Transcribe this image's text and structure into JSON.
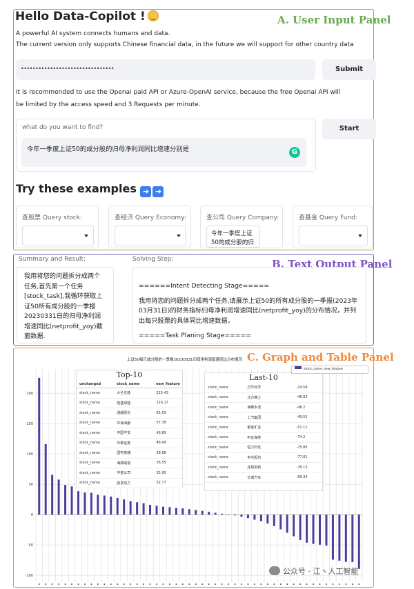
{
  "panels": {
    "a_title": "A. User Input Panel",
    "b_title": "B. Text Output Panel",
    "c_title": "C. Graph and Table Panel"
  },
  "header": {
    "title": "Hello Data-Copilot !",
    "subtitle_1": "A powerful AI system connects humans and data.",
    "subtitle_2": "The current version only supports Chinese financial data, in the future we will support for other country data"
  },
  "api": {
    "key_value": "••••••••••••••••••••••••••••••••",
    "submit_label": "Submit",
    "note_1": "It is recommended to use the Openai paid API or Azure-OpenAI service, because the free Openai API will",
    "note_2": "be limited by the access speed and 3 Requests per minute."
  },
  "query": {
    "label": "what do you want to find?",
    "value": "今年一季度上证50的成分股的归母净利润同比增速分别是",
    "start_label": "Start"
  },
  "examples": {
    "heading": "Try these examples",
    "items": [
      {
        "label": "查股票 Query stock:",
        "value": ""
      },
      {
        "label": "查经济 Query Economy:",
        "value": ""
      },
      {
        "label": "查公司 Query Company:",
        "value": "今年一季度上证50的成分股的归母净"
      },
      {
        "label": "查基金 Query Fund:",
        "value": ""
      }
    ]
  },
  "output": {
    "summary_label": "Summary and Result:",
    "summary_text": "我用将您的问题拆分成两个任务,首先第一个任务[stock_task],我循环获取上证50所有成分股的一季报20230331日的归母净利润增速同比(netprofit_yoy)截面数据.\n然后第二个任务",
    "solving_label": "Solving Step:",
    "solving_line1": "======Intent Detecting Stage=====",
    "solving_text": "我用将您的问题拆分成两个任务,请展示上证50的所有成分股的一季报(2023年03月31日)的财务指标归母净利润增速同比(netprofit_yoy)的分布情况，并列出每只股票的具体同比增速数据。",
    "solving_line3": "=====Task Planing Stage====="
  },
  "chart_data": {
    "type": "bar",
    "title": "上证50每只成分股的一季报20230331归母净利润增速同比分布情况",
    "legend": "stock_name_new_feature",
    "legend_position": "top-right",
    "yticks": [
      200,
      150,
      100,
      50,
      0,
      -50,
      -100
    ],
    "ylim": [
      -110,
      240
    ],
    "color": "#4b3f9a",
    "values": [
      225.43,
      116.17,
      65.59,
      57.78,
      48.89,
      46.49,
      38.68,
      36.55,
      35.95,
      32.77,
      31.5,
      29.8,
      27.6,
      25.1,
      22.3,
      20.4,
      18.9,
      16.2,
      14.7,
      13.1,
      12.4,
      11.2,
      10.3,
      9.1,
      7.6,
      6.2,
      4.8,
      3.1,
      1.6,
      0.4,
      -1.2,
      -3.5,
      -5.8,
      -8.3,
      -10.9,
      -14.6,
      -18.8,
      -24.2,
      -29.9,
      -35.6,
      -41.7,
      -46.2,
      -48.2,
      -49.55,
      -51.11,
      -74.2,
      -75.86,
      -77.81,
      -78.13,
      -89.34
    ],
    "top10": {
      "title": "Top-10",
      "headers": [
        "unchanged",
        "stock_name",
        "new_feature"
      ],
      "rows": [
        [
          "stock_name",
          "大全光能",
          "225.43"
        ],
        [
          "stock_name",
          "隆基绿能",
          "116.17"
        ],
        [
          "stock_name",
          "通威股份",
          "65.59"
        ],
        [
          "stock_name",
          "中海油服",
          "57.78"
        ],
        [
          "stock_name",
          "中国平安",
          "48.89"
        ],
        [
          "stock_name",
          "华泰证券",
          "46.49"
        ],
        [
          "stock_name",
          "国电南瑞",
          "38.68"
        ],
        [
          "stock_name",
          "海康威视",
          "36.55"
        ],
        [
          "stock_name",
          "中金公司",
          "35.95"
        ],
        [
          "stock_name",
          "航发动力",
          "32.77"
        ]
      ]
    },
    "last10": {
      "title": "Last-10",
      "rows": [
        [
          "stock_name",
          "万华化学",
          "-24.58"
        ],
        [
          "stock_name",
          "北方稀土",
          "-46.83"
        ],
        [
          "stock_name",
          "海螺水泥",
          "-48.2"
        ],
        [
          "stock_name",
          "上汽集团",
          "-49.55"
        ],
        [
          "stock_name",
          "紫金矿业",
          "-51.11"
        ],
        [
          "stock_name",
          "中远海控",
          "-74.2"
        ],
        [
          "stock_name",
          "恒力石化",
          "-75.86"
        ],
        [
          "stock_name",
          "韦尔股份",
          "-77.81"
        ],
        [
          "stock_name",
          "兆易创新",
          "-78.13"
        ],
        [
          "stock_name",
          "长城汽车",
          "-89.34"
        ]
      ]
    }
  },
  "watermark": "公众号 · 江丶人工智能"
}
